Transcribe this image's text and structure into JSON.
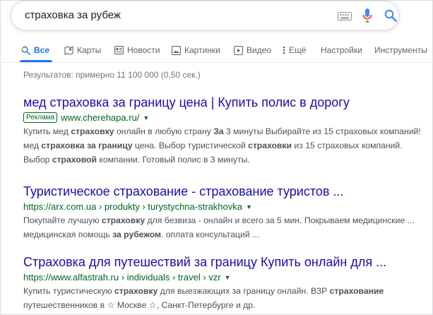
{
  "search": {
    "query": "страховка за рубеж"
  },
  "tabs": [
    {
      "label": "Все",
      "icon": "search-icon",
      "active": true
    },
    {
      "label": "Карты",
      "icon": "map-icon"
    },
    {
      "label": "Новости",
      "icon": "news-icon"
    },
    {
      "label": "Картинки",
      "icon": "image-icon"
    },
    {
      "label": "Видео",
      "icon": "video-icon"
    },
    {
      "label": "Ещё",
      "icon": "more-vert-icon"
    },
    {
      "label": "Настройки"
    },
    {
      "label": "Инструменты"
    }
  ],
  "stats": "Результатов: примерно 11 100 000 (0,50 сек.)",
  "results": [
    {
      "title": "мед страховка за границу цена | Купить полис в дорогу",
      "ad_label": "Реклама",
      "url": "www.cherehapa.ru/",
      "snippet": [
        {
          "t": "Купить мед "
        },
        {
          "b": "страховку"
        },
        {
          "t": " онлайн в любую страну "
        },
        {
          "b": "За"
        },
        {
          "t": " 3 минуты Выбирайте из 15 страховых компаний! мед "
        },
        {
          "b": "страховка за границу"
        },
        {
          "t": " цена. Выбор туристической "
        },
        {
          "b": "страховки"
        },
        {
          "t": " из 15 страховых компаний. Выбор "
        },
        {
          "b": "страховой"
        },
        {
          "t": " компании. Готовый полис в 3 минуты."
        }
      ]
    },
    {
      "title": "Туристическое страхование - страхование туристов ...",
      "url": "https://arx.com.ua › produkty › turystychna-strakhovka",
      "snippet": [
        {
          "t": "Покупайте лучшую "
        },
        {
          "b": "страховку"
        },
        {
          "t": " для безвиза - онлайн и всего за 5 мин. Покрываем медицинские ... медицинская помощь "
        },
        {
          "b": "за рубежом"
        },
        {
          "t": ". оплата консультаций ..."
        }
      ]
    },
    {
      "title": "Страховка для путешествий за границу Купить онлайн для ...",
      "url": "https://www.alfastrah.ru › individuals › travel › vzr",
      "snippet": [
        {
          "t": "Купить туристическую "
        },
        {
          "b": "страховку"
        },
        {
          "t": " для выезжающих за границу онлайн. ВЗР "
        },
        {
          "b": "страхование"
        },
        {
          "t": " путешественников в ☆ Москве ☆, Санкт-Петербурге и др."
        }
      ]
    }
  ],
  "colors": {
    "link": "#1a0dab",
    "url_green": "#006621",
    "accent_blue": "#1a73e8",
    "snippet_gray": "#4d5156"
  }
}
